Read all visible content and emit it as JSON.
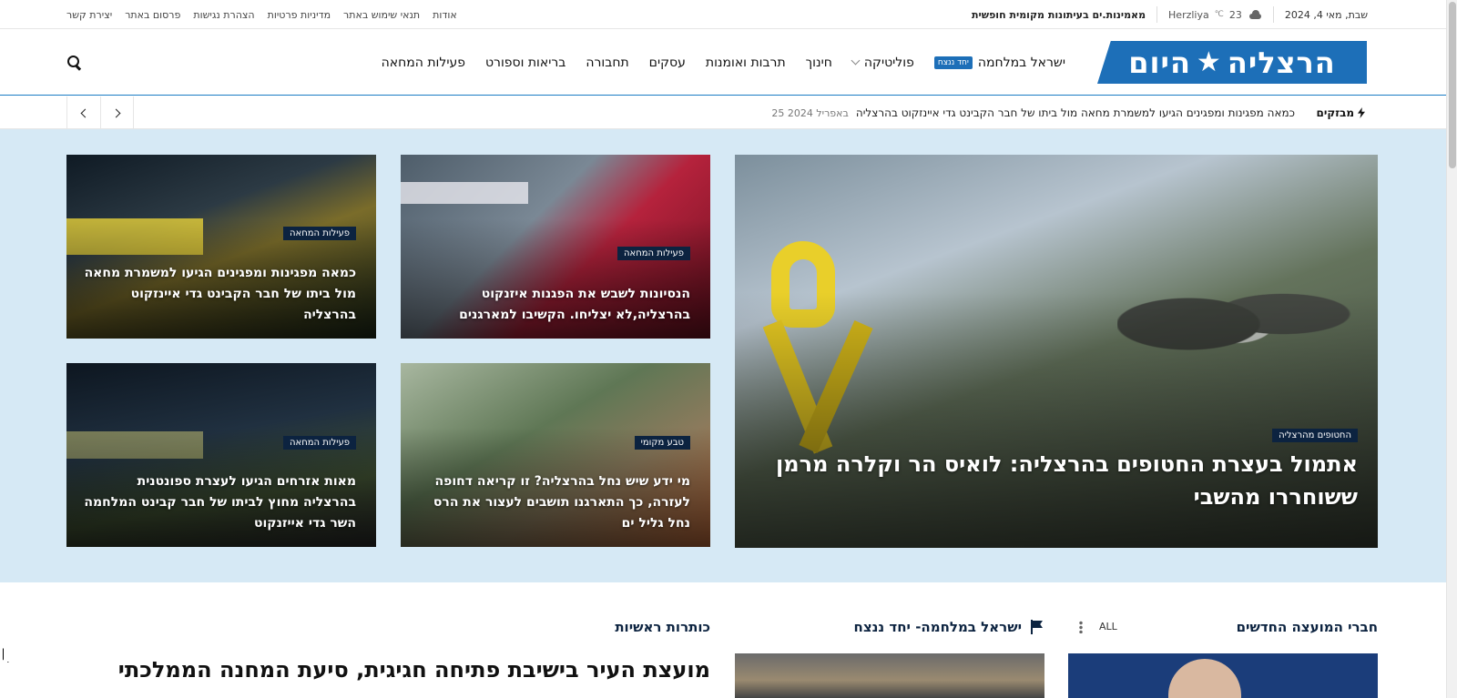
{
  "topbar": {
    "links": [
      "יצירת קשר",
      "פרסום באתר",
      "הצהרת נגישות",
      "מדיניות פרטיות",
      "תנאי שימוש באתר",
      "אודות"
    ],
    "tagline": "מאמינות.ים בעיתונות מקומית חופשית",
    "weather_city": "Herzliya",
    "weather_temp": "23",
    "weather_unit": "℃",
    "date": "שבת, מאי 4, 2024"
  },
  "header": {
    "logo_text_1": "הרצליה",
    "logo_text_2": "היום",
    "nav": [
      {
        "label": "ישראל במלחמה",
        "badge": "יחד ננצח"
      },
      {
        "label": "פוליטיקה",
        "dropdown": true
      },
      {
        "label": "חינוך"
      },
      {
        "label": "תרבות ואומנות"
      },
      {
        "label": "עסקים"
      },
      {
        "label": "תחבורה"
      },
      {
        "label": "בריאות וספורט"
      },
      {
        "label": "פעילות המחאה"
      }
    ]
  },
  "ticker": {
    "label": "מבזקים",
    "text": "כמאה מפגינות ומפגינים הגיעו למשמרת מחאה מול ביתו של חבר הקבינט גדי איינזקוט בהרצליה",
    "date": "25 באפריל 2024"
  },
  "hero": {
    "main": {
      "category": "החטופים מהרצליה",
      "title": "אתמול בעצרת החטופים בהרצליה: לואיס הר וקלרה מרמן ששוחררו מהשבי"
    },
    "cards": [
      {
        "category": "פעילות המחאה",
        "title": "הנסיונות לשבש את הפגנות איזנקוט בהרצליה,לא יצליחו. הקשיבו למארגנים"
      },
      {
        "category": "פעילות המחאה",
        "title": "כמאה מפגינות ומפגינים הגיעו למשמרת מחאה מול ביתו של חבר הקבינט גדי איינזקוט בהרצליה"
      },
      {
        "category": "טבע מקומי",
        "title": "מי ידע שיש נחל בהרצליה? זו קריאה דחופה לעזרה, כך התארגנו תושבים לעצור את הרס נחל גליל ים"
      },
      {
        "category": "פעילות המחאה",
        "title": "מאות אזרחים הגיעו לעצרת ספונטנית בהרצליה מחוץ לביתו של חבר קבינט המלחמה השר גדי אייזנקוט"
      }
    ]
  },
  "sections": {
    "council": "חברי המועצה החדשים",
    "all": "ALL",
    "war": "ישראל במלחמה- יחד ננצח",
    "headlines": "כותרות ראשיות",
    "headline_title": "מועצת העיר בישיבת פתיחה חגיגית, סיעת המחנה הממלכתי"
  }
}
